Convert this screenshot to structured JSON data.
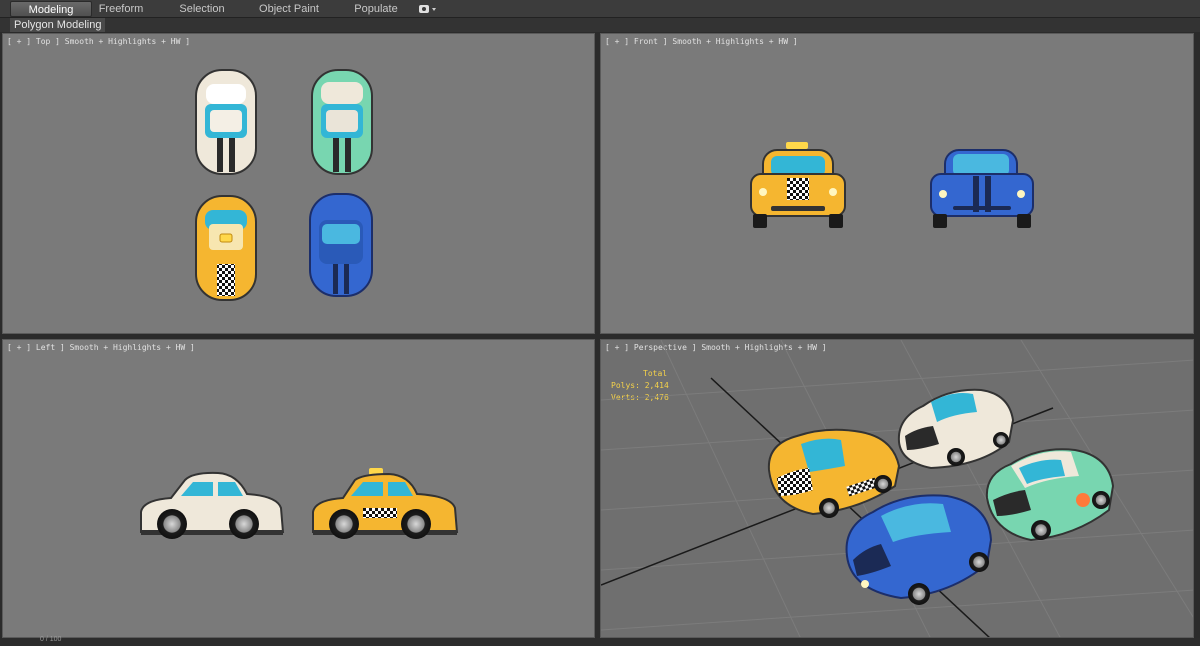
{
  "ribbon": {
    "tabs": [
      {
        "label": "Modeling",
        "active": true
      },
      {
        "label": "Freeform",
        "active": false
      },
      {
        "label": "Selection",
        "active": false
      },
      {
        "label": "Object Paint",
        "active": false
      },
      {
        "label": "Populate",
        "active": false
      }
    ],
    "dropdown_icon": "camera-dropdown-icon"
  },
  "subbar": {
    "label": "Polygon Modeling"
  },
  "viewports": {
    "top": {
      "label": "[ + ] Top ] Smooth + Highlights + HW ]"
    },
    "front": {
      "label": "[ + ] Front ] Smooth + Highlights + HW ]"
    },
    "left": {
      "label": "[ + ] Left ] Smooth + Highlights + HW ]"
    },
    "perspective": {
      "label": "[ + ] Perspective ] Smooth + Highlights + HW ]",
      "stats": {
        "total_label": "Total",
        "polys": "Polys: 2,414",
        "verts": "Verts: 2,476"
      }
    }
  },
  "colors": {
    "viewport_bg": "#7a7a7a",
    "white_car": "#efe8da",
    "mint_car": "#6fd1a8",
    "taxi_car": "#f5b630",
    "blue_car": "#3467d0",
    "window": "#33b6d6",
    "stats_text": "#f5d24a"
  },
  "status": {
    "text": "0 / 100"
  }
}
